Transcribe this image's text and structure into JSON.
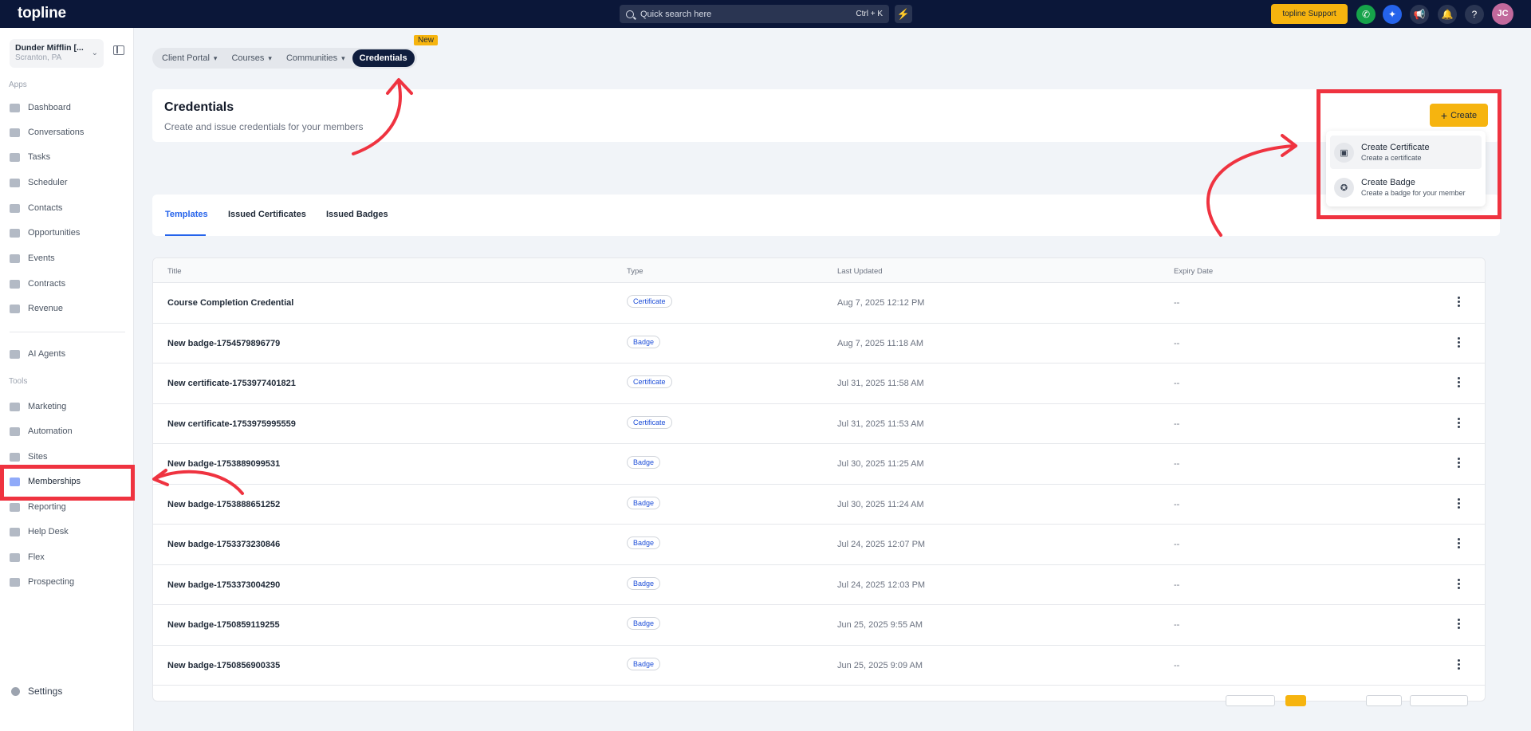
{
  "topbar": {
    "logo": "topline",
    "search_placeholder": "Quick search here",
    "search_shortcut": "Ctrl + K",
    "support_label": "topline Support",
    "avatar_initials": "JC"
  },
  "sidebar": {
    "account_name": "Dunder Mifflin [...",
    "account_location": "Scranton, PA",
    "apps_label": "Apps",
    "apps": [
      "Dashboard",
      "Conversations",
      "Tasks",
      "Scheduler",
      "Contacts",
      "Opportunities",
      "Events",
      "Contracts",
      "Revenue"
    ],
    "ai_agents": "AI Agents",
    "tools_label": "Tools",
    "tools": [
      "Marketing",
      "Automation",
      "Sites",
      "Memberships",
      "Reporting",
      "Help Desk",
      "Flex",
      "Prospecting"
    ],
    "settings": "Settings"
  },
  "nav_pills": {
    "items": [
      "Client Portal",
      "Courses",
      "Communities",
      "Credentials"
    ],
    "new_badge": "New"
  },
  "header": {
    "title": "Credentials",
    "subtitle": "Create and issue credentials for your members",
    "create_label": "Create"
  },
  "dropdown": {
    "items": [
      {
        "title": "Create Certificate",
        "subtitle": "Create a certificate"
      },
      {
        "title": "Create Badge",
        "subtitle": "Create a badge for your member"
      }
    ]
  },
  "tabs": [
    "Templates",
    "Issued Certificates",
    "Issued Badges"
  ],
  "table": {
    "columns": [
      "Title",
      "Type",
      "Last Updated",
      "Expiry Date"
    ],
    "rows": [
      {
        "title": "Course Completion Credential",
        "type": "Certificate",
        "updated": "Aug 7, 2025 12:12 PM",
        "expiry": "--"
      },
      {
        "title": "New badge-1754579896779",
        "type": "Badge",
        "updated": "Aug 7, 2025 11:18 AM",
        "expiry": "--"
      },
      {
        "title": "New certificate-1753977401821",
        "type": "Certificate",
        "updated": "Jul 31, 2025 11:58 AM",
        "expiry": "--"
      },
      {
        "title": "New certificate-1753975995559",
        "type": "Certificate",
        "updated": "Jul 31, 2025 11:53 AM",
        "expiry": "--"
      },
      {
        "title": "New badge-1753889099531",
        "type": "Badge",
        "updated": "Jul 30, 2025 11:25 AM",
        "expiry": "--"
      },
      {
        "title": "New badge-1753888651252",
        "type": "Badge",
        "updated": "Jul 30, 2025 11:24 AM",
        "expiry": "--"
      },
      {
        "title": "New badge-1753373230846",
        "type": "Badge",
        "updated": "Jul 24, 2025 12:07 PM",
        "expiry": "--"
      },
      {
        "title": "New badge-1753373004290",
        "type": "Badge",
        "updated": "Jul 24, 2025 12:03 PM",
        "expiry": "--"
      },
      {
        "title": "New badge-1750859119255",
        "type": "Badge",
        "updated": "Jun 25, 2025 9:55 AM",
        "expiry": "--"
      },
      {
        "title": "New badge-1750856900335",
        "type": "Badge",
        "updated": "Jun 25, 2025 9:09 AM",
        "expiry": "--"
      }
    ]
  },
  "colors": {
    "topbar_bg": "#0b1739",
    "accent": "#f6b40f",
    "active_tab": "#2563eb",
    "annotation": "#ef3340"
  }
}
